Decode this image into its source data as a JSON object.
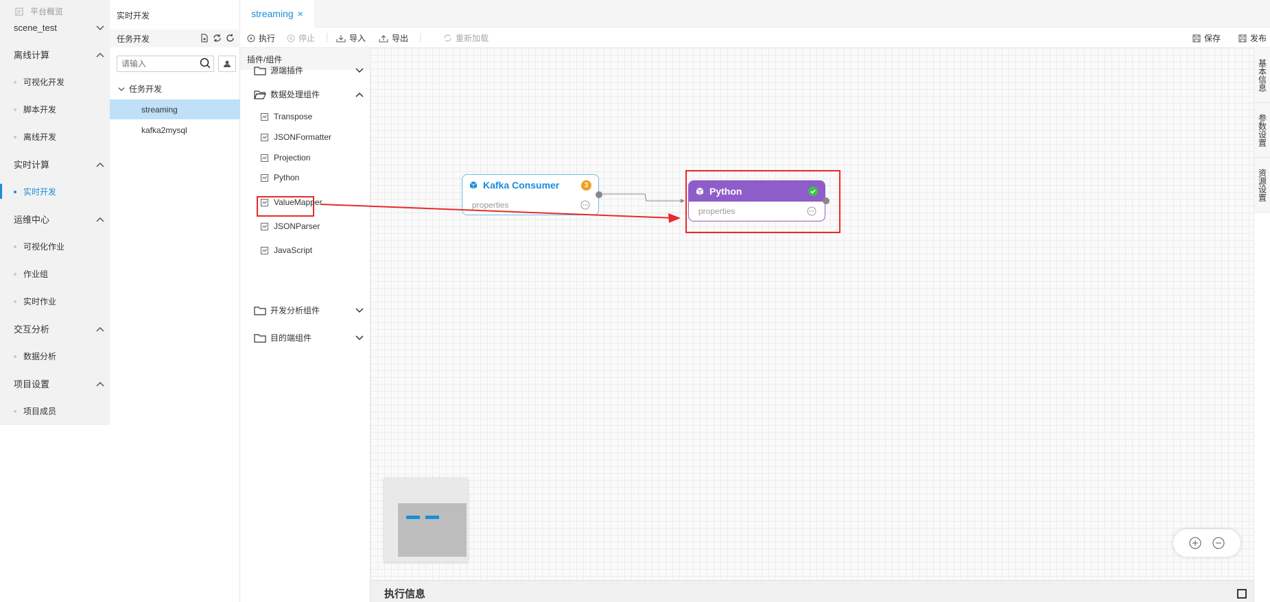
{
  "leftnav": {
    "overview": "平台概览",
    "project": "scene_test",
    "groups": [
      {
        "label": "离线计算",
        "items": [
          "可视化开发",
          "脚本开发",
          "离线开发"
        ]
      },
      {
        "label": "实时计算",
        "items": [
          "实时开发"
        ]
      },
      {
        "label": "运维中心",
        "items": [
          "可视化作业",
          "作业组",
          "实时作业"
        ]
      },
      {
        "label": "交互分析",
        "items": [
          "数据分析"
        ]
      },
      {
        "label": "项目设置",
        "items": [
          "项目成员"
        ]
      }
    ],
    "active_item": "实时开发"
  },
  "taskpanel": {
    "title": "实时开发",
    "subtitle": "任务开发",
    "search_placeholder": "请输入",
    "tree_root": "任务开发",
    "items": [
      "streaming",
      "kafka2mysql"
    ],
    "selected": "streaming"
  },
  "tabs": [
    {
      "label": "streaming",
      "close": "×"
    }
  ],
  "toolbar": {
    "run": "执行",
    "stop": "停止",
    "import": "导入",
    "export": "导出",
    "reload": "重新加载",
    "save": "保存",
    "publish": "发布"
  },
  "components": {
    "header": "插件/组件",
    "folders": [
      {
        "label": "源端插件",
        "expanded": false
      },
      {
        "label": "数据处理组件",
        "expanded": true,
        "items": [
          "Transpose",
          "JSONFormatter",
          "Projection",
          "Python",
          "ValueMapper",
          "JSONParser",
          "JavaScript"
        ]
      },
      {
        "label": "开发分析组件",
        "expanded": false
      },
      {
        "label": "目的端组件",
        "expanded": false
      }
    ]
  },
  "canvas": {
    "nodes": [
      {
        "title": "Kafka Consumer",
        "body": "properties",
        "badge": "3",
        "color": "#1a8cdb"
      },
      {
        "title": "Python",
        "body": "properties",
        "status": "ok",
        "color": "#8e5dc9"
      }
    ]
  },
  "rightbar": {
    "tabs": [
      "基本信息",
      "参数设置",
      "资源设置"
    ]
  },
  "execinfo": {
    "title": "执行信息"
  },
  "colors": {
    "accent": "#1a8cdb",
    "highlight": "#e8282b",
    "python_node": "#8e5dc9"
  }
}
